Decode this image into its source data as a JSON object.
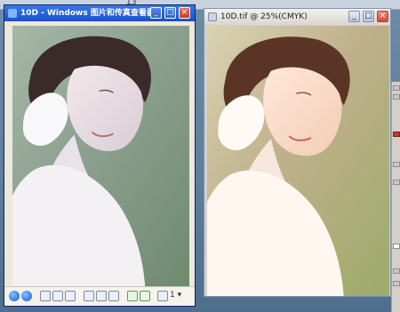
{
  "top_strip": {
    "number": "13"
  },
  "window_left": {
    "title": "10D - Windows 图片和传真查看器",
    "controls": {
      "minimize": "_",
      "maximize": "□",
      "close": "×"
    },
    "toolbar": {
      "page_indicator": "1 ▾"
    }
  },
  "window_right": {
    "title": "10D.tif @ 25%(CMYK)",
    "controls": {
      "minimize": "_",
      "maximize": "□",
      "close": "×"
    }
  },
  "colors": {
    "xp_titlebar": "#1a50c8",
    "close_red": "#c63c22",
    "desktop": "#5f7f9c"
  }
}
